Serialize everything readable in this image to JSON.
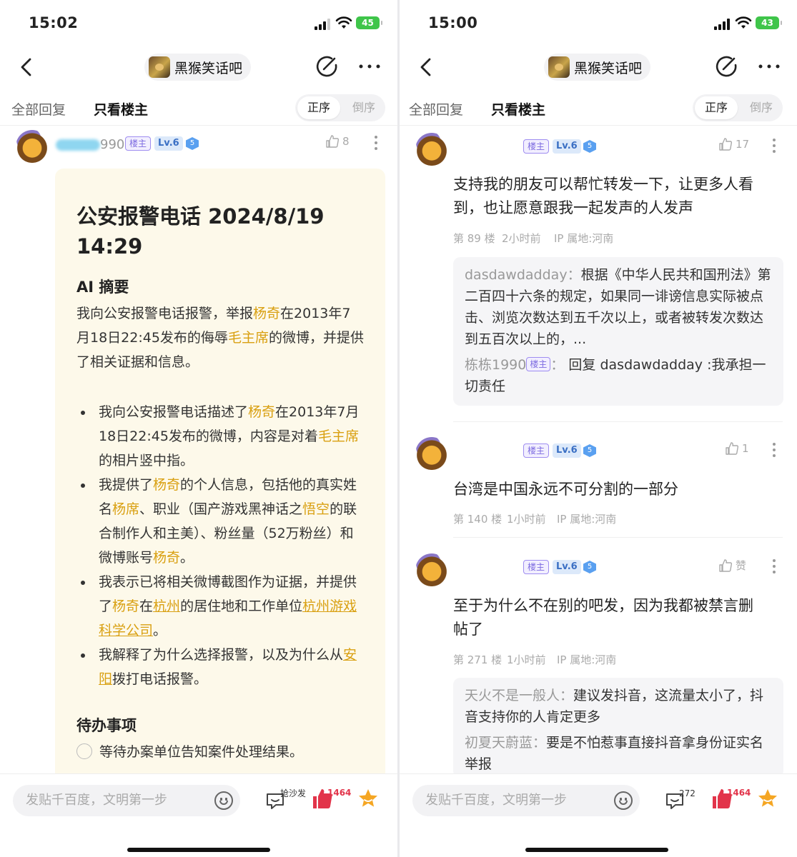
{
  "left": {
    "time": "15:02",
    "battery": "45",
    "forum_name": "黑猴笑话吧",
    "tabs": {
      "all": "全部回复",
      "op": "只看楼主"
    },
    "order": {
      "asc": "正序",
      "desc": "倒序"
    },
    "user": {
      "name_suffix": "990",
      "lz": "楼主",
      "level": "Lv.6",
      "vip": "5",
      "likes": "8"
    },
    "card": {
      "title": "公安报警电话 2024/8/19 14:29",
      "summary_heading": "AI 摘要",
      "summary": [
        "我向公安报警电话报警，举报",
        "杨奇",
        "在2013年7月18日22:45发布的侮辱",
        "毛主席",
        "的微博，并提供了相关证据和信息。"
      ],
      "b1": [
        "我向公安报警电话描述了",
        "杨奇",
        "在2013年7月18日22:45发布的微博，内容是对着",
        "毛主席",
        "的相片竖中指。"
      ],
      "b2": [
        "我提供了",
        "杨奇",
        "的个人信息，包括他的真实姓名",
        "杨席",
        "、职业（国产游戏黑神话之",
        "悟空",
        "的联合制作人和主美）、粉丝量（52万粉丝）和微博账号",
        "杨奇",
        "。"
      ],
      "b3": [
        "我表示已将相关微博截图作为证据，并提供了",
        "杨奇",
        "在",
        "杭州",
        "的居住地和工作单位",
        "杭州游戏科学公司",
        "。"
      ],
      "b4": [
        "我解释了为什么选择报警，以及为什么从",
        "安阳",
        "拨打电话报警。"
      ],
      "todo_heading": "待办事项",
      "todo_item": "等待办案单位告知案件处理结果。"
    },
    "bottom": {
      "placeholder": "发贴千百度，文明第一步",
      "sofa": "抢沙发",
      "likes": "1464"
    }
  },
  "right": {
    "time": "15:00",
    "battery": "43",
    "forum_name": "黑猴笑话吧",
    "tabs": {
      "all": "全部回复",
      "op": "只看楼主"
    },
    "order": {
      "asc": "正序",
      "desc": "倒序"
    },
    "posts": [
      {
        "lz": "楼主",
        "level": "Lv.6",
        "vip": "5",
        "likes": "17",
        "text": "支持我的朋友可以帮忙转发一下，让更多人看到，也让愿意跟我一起发声的人发声",
        "floor": "第 89 楼",
        "ago": "2小时前",
        "ip": "IP 属地:河南",
        "replies": [
          {
            "name": "dasdawdadday",
            "sep": "：",
            "text": "根据《中华人民共和国刑法》第二百四十六条的规定，如果同一诽谤信息实际被点击、浏览次数达到五千次以上，或者被转发次数达到五百次以上的，..."
          },
          {
            "name": "栋栋1990",
            "lz": "楼主",
            "sep": "：",
            "text": " 回复 dasdawdadday :我承担一切责任"
          }
        ]
      },
      {
        "lz": "楼主",
        "level": "Lv.6",
        "vip": "5",
        "likes": "1",
        "text": "台湾是中国永远不可分割的一部分",
        "floor": "第 140 楼",
        "ago": "1小时前",
        "ip": "IP 属地:河南"
      },
      {
        "lz": "楼主",
        "level": "Lv.6",
        "vip": "5",
        "likes": "赞",
        "text": "至于为什么不在别的吧发，因为我都被禁言删帖了",
        "floor": "第 271 楼",
        "ago": "1小时前",
        "ip": "IP 属地:河南",
        "replies": [
          {
            "name": "天火不是一般人",
            "sep": "：",
            "text": "建议发抖音，这流量太小了，抖音支持你的人肯定更多"
          },
          {
            "name": "初夏天蔚蓝",
            "sep": "：",
            "text": "要是不怕惹事直接抖音拿身份证实名举报"
          }
        ]
      }
    ],
    "bottom": {
      "placeholder": "发贴千百度，文明第一步",
      "comments": "272",
      "likes": "1464"
    }
  },
  "colors": {
    "highlight": "#d9a011",
    "lz_badge": "#7d6be0",
    "level_badge": "#3a6fc4",
    "like_red": "#e2344a",
    "battery_green": "#3fc54a"
  }
}
